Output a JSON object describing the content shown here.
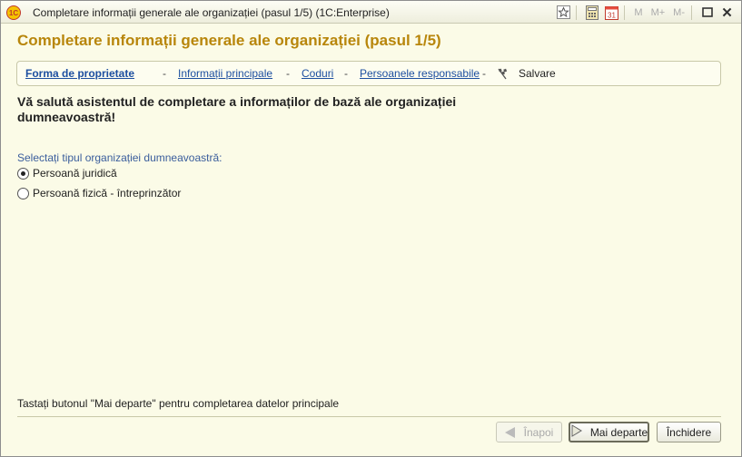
{
  "window": {
    "title": "Completare informații generale ale organizației (pasul 1/5)  (1C:Enterprise)",
    "logo_text": "1C",
    "toolbar": {
      "m_label": "M",
      "mplus_label": "M+",
      "mminus_label": "M-",
      "calendar_label": "31"
    }
  },
  "heading": "Completare informații generale ale organizației (pasul 1/5)",
  "steps": [
    {
      "label": "Forma de proprietate",
      "state": "active"
    },
    {
      "label": "Informații principale",
      "state": "link"
    },
    {
      "label": "Coduri",
      "state": "link"
    },
    {
      "label": "Persoanele responsabile",
      "state": "link"
    },
    {
      "label": "Salvare",
      "state": "plain"
    }
  ],
  "step_separator": "-",
  "welcome": "Vă salută asistentul de completare a informaților de bază ale organizației dumneavoastră!",
  "select_label": "Selectați tipul organizației dumneavoastră:",
  "radios": [
    {
      "label": "Persoană juridică",
      "checked": true
    },
    {
      "label": "Persoană fizică - întreprinzător",
      "checked": false
    }
  ],
  "hint": "Tastați butonul \"Mai departe\" pentru completarea datelor principale",
  "buttons": {
    "back": "Înapoi",
    "next": "Mai departe",
    "close": "Închidere"
  }
}
